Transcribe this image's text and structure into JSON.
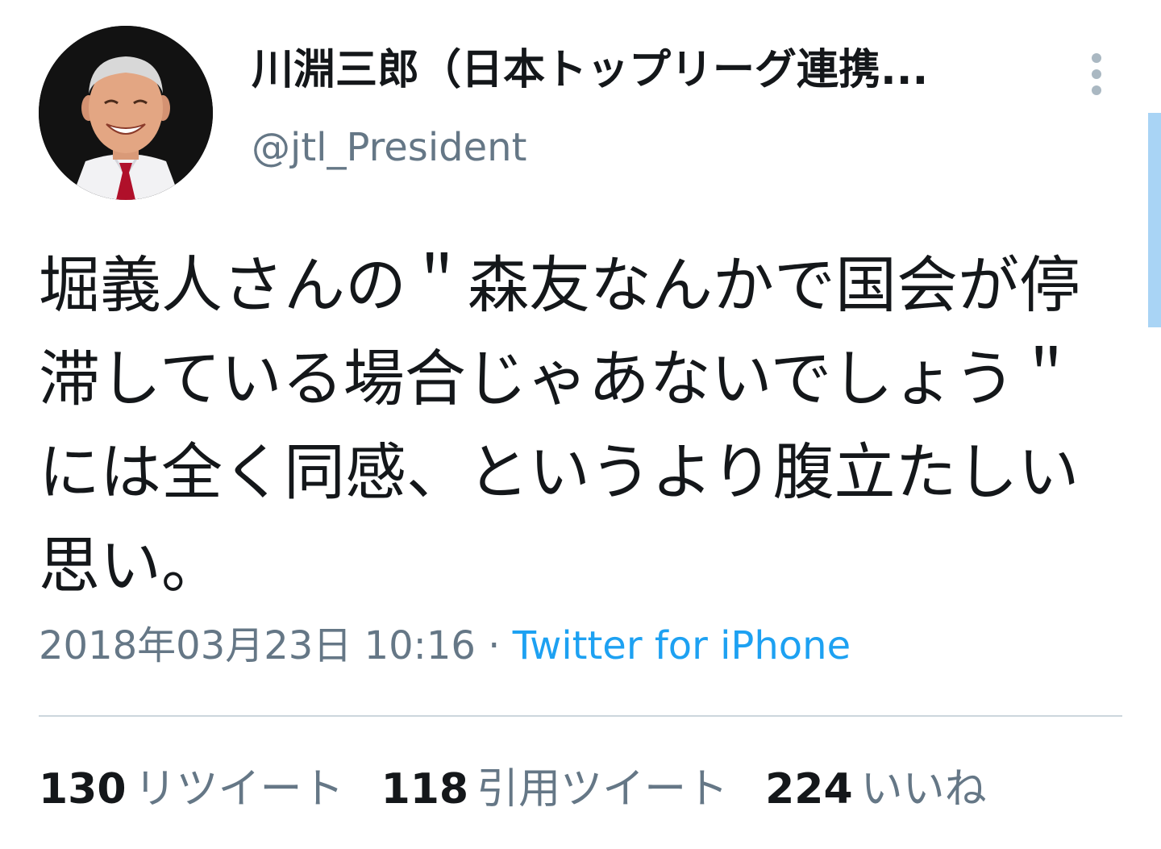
{
  "tweet": {
    "author": {
      "display_name": "川淵三郎（日本トップリーグ連携...",
      "handle": "@jtl_President",
      "avatar": "profile-photo"
    },
    "text": "堀義人さんの＂森友なんかで国会が停滞している場合じゃあないでしょう＂には全く同感、というより腹立たしい思い。",
    "timestamp": "2018年03月23日 10:16",
    "separator": " · ",
    "source": "Twitter for iPhone",
    "stats": {
      "retweets": {
        "count": "130",
        "label": "リツイート"
      },
      "quotes": {
        "count": "118",
        "label": "引用ツイート"
      },
      "likes": {
        "count": "224",
        "label": "いいね"
      }
    }
  },
  "icons": {
    "more": "more-vertical-icon"
  },
  "colors": {
    "text": "#14171a",
    "secondary": "#657786",
    "link": "#1da1f2",
    "divider": "#ccd6dd",
    "scrollbar": "#a9d4f5"
  }
}
